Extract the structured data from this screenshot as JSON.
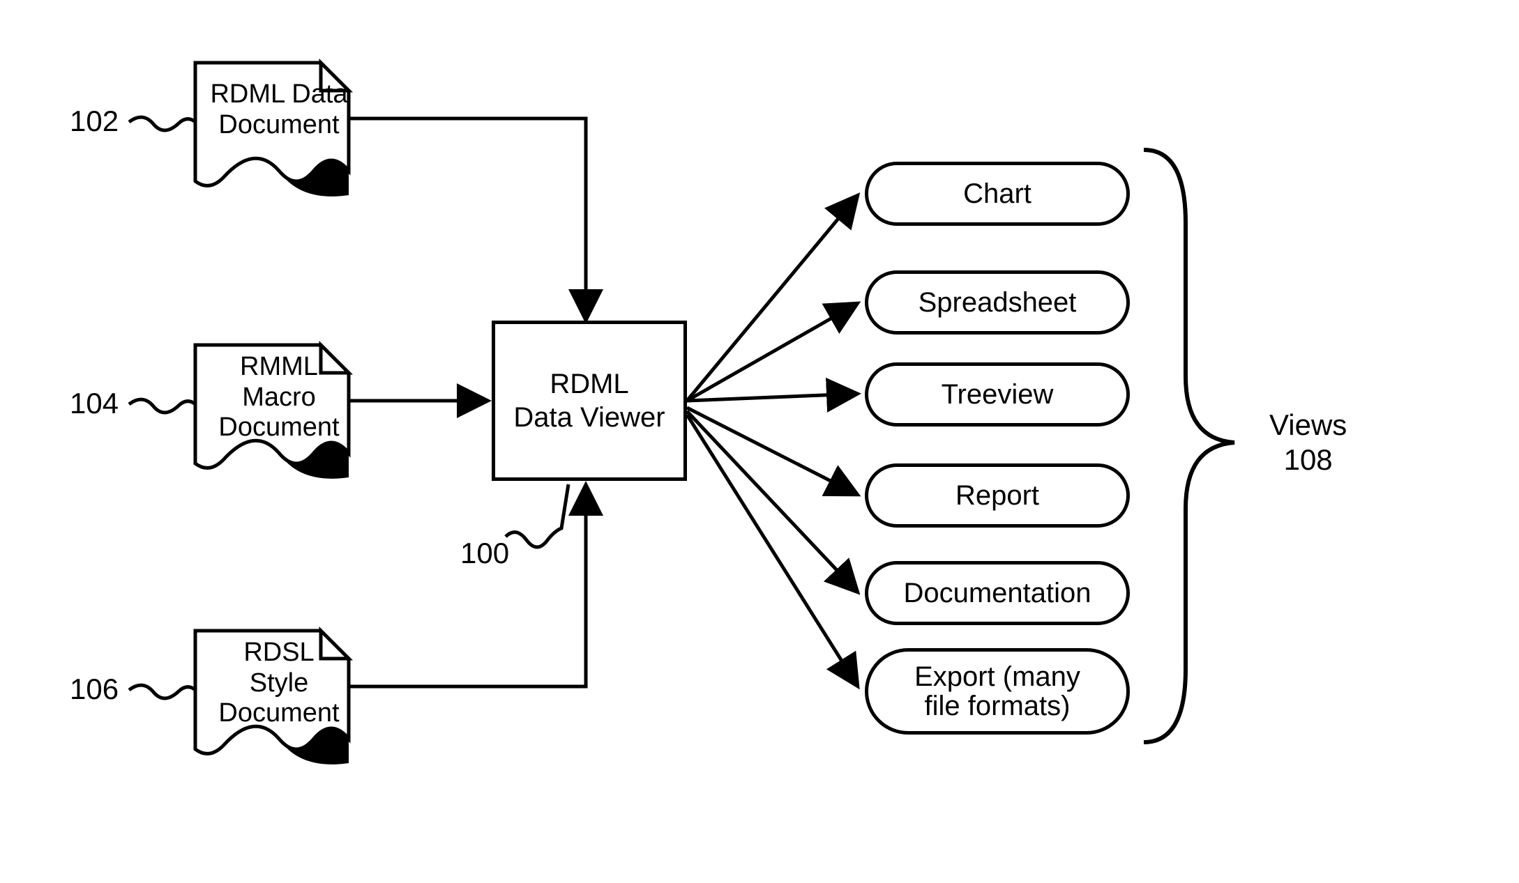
{
  "refs": {
    "r102": "102",
    "r104": "104",
    "r106": "106",
    "r100": "100",
    "r108_line1": "Views",
    "r108_line2": "108"
  },
  "docs": {
    "d1_line1": "RDML Data",
    "d1_line2": "Document",
    "d2_line1": "RMML",
    "d2_line2": "Macro",
    "d2_line3": "Document",
    "d3_line1": "RDSL",
    "d3_line2": "Style",
    "d3_line3": "Document"
  },
  "center": {
    "line1": "RDML",
    "line2": "Data Viewer"
  },
  "views": {
    "v1": "Chart",
    "v2": "Spreadsheet",
    "v3": "Treeview",
    "v4": "Report",
    "v5": "Documentation",
    "v6_line1": "Export (many",
    "v6_line2": "file formats)"
  }
}
